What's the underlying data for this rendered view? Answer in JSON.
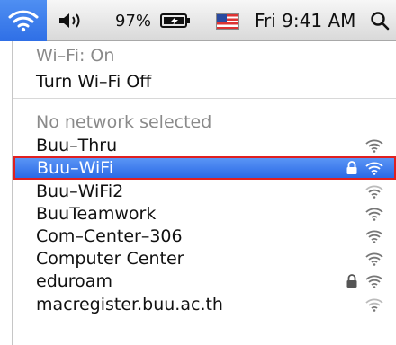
{
  "menubar": {
    "volume_icon": "speaker-volume-icon",
    "battery_text": "97%",
    "battery_icon": "battery-charging-icon",
    "flag_icon": "us-flag-input-source-icon",
    "clock": "Fri 9:41 AM",
    "search_icon": "spotlight-search-icon",
    "wifi_icon": "wifi-icon",
    "active_color": "#2f6fe6"
  },
  "wifi_menu": {
    "status": "Wi–Fi: On",
    "toggle_label": "Turn Wi–Fi Off",
    "section_label": "No network selected",
    "selected_highlight": "#e02020",
    "networks": [
      {
        "name": "Buu–Thru",
        "locked": false,
        "signal_icon": "wifi-signal-icon"
      },
      {
        "name": "Buu–WiFi",
        "locked": true,
        "selected": true,
        "signal_icon": "wifi-signal-icon"
      },
      {
        "name": "Buu–WiFi2",
        "locked": false,
        "signal_icon": "wifi-signal-icon"
      },
      {
        "name": "BuuTeamwork",
        "locked": false,
        "signal_icon": "wifi-signal-icon"
      },
      {
        "name": "Com–Center–306",
        "locked": false,
        "signal_icon": "wifi-signal-icon"
      },
      {
        "name": "Computer Center",
        "locked": false,
        "signal_icon": "wifi-signal-icon"
      },
      {
        "name": "eduroam",
        "locked": true,
        "signal_icon": "wifi-signal-icon"
      },
      {
        "name": "macregister.buu.ac.th",
        "locked": false,
        "signal_icon": "wifi-signal-icon"
      }
    ]
  }
}
